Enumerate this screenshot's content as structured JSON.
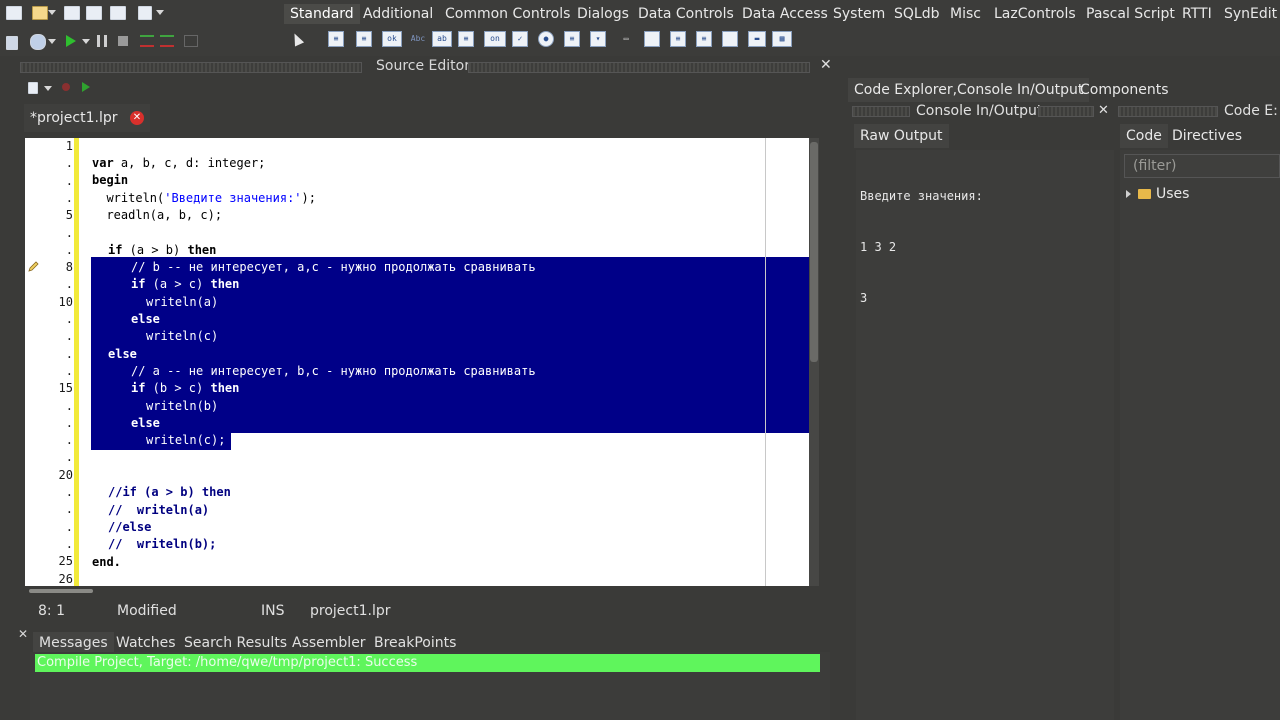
{
  "palette": {
    "tabs": [
      "Standard",
      "Additional",
      "Common Controls",
      "Dialogs",
      "Data Controls",
      "Data Access",
      "System",
      "SQLdb",
      "Misc",
      "LazControls",
      "Pascal Script",
      "RTTI",
      "SynEdit"
    ],
    "active_index": 0
  },
  "source_editor": {
    "title": "Source Editor",
    "close": "✕",
    "tab_label": "*project1.lpr",
    "tab_close": "✕"
  },
  "gutter": {
    "labels": [
      "1",
      ".",
      ".",
      ".",
      "5",
      ".",
      ".",
      "8",
      ".",
      "10",
      ".",
      ".",
      ".",
      ".",
      "15",
      ".",
      ".",
      ".",
      ".",
      "20",
      ".",
      ".",
      ".",
      ".",
      "25",
      "26"
    ]
  },
  "code": {
    "line1": "",
    "line2_kw": "var",
    "line2_rest": " a, b, c, d: integer;",
    "line3": "begin",
    "line4_a": "  writeln(",
    "line4_str": "'Введите значения:'",
    "line4_b": ");",
    "line5": "  readln(a, b, c);",
    "line7_kw1": "if",
    "line7_mid": " (a > b) ",
    "line7_kw2": "then",
    "line8_cmt": "// b -- не интересует, a,c - нужно продолжать сравнивать",
    "line9_kw1": "if",
    "line9_mid": " (a > c) ",
    "line9_kw2": "then",
    "line10": "writeln(a)",
    "line11": "else",
    "line12": "writeln(c)",
    "line13": "else",
    "line14_cmt": "// a -- не интересует, b,c - нужно продолжать сравнивать",
    "line15_kw1": "if",
    "line15_mid": " (b > c) ",
    "line15_kw2": "then",
    "line16": "writeln(b)",
    "line17": "else",
    "line18": "writeln(c);",
    "line22": "//if (a > b) then",
    "line23": "//  writeln(a)",
    "line24": "//else",
    "line25c": "//  writeln(b);",
    "line26": "end."
  },
  "status": {
    "position": "8: 1",
    "state": "Modified",
    "mode": "INS",
    "file": "project1.lpr"
  },
  "messages": {
    "tabs": [
      "Messages",
      "Watches",
      "Search Results",
      "Assembler",
      "BreakPoints"
    ],
    "line": "Compile Project, Target: /home/qwe/tmp/project1: Success"
  },
  "right_dock": {
    "tab_main": "Code Explorer,Console In/Output",
    "tab_components": "Components",
    "console_title": "Console In/Output",
    "console_close": "✕",
    "code_ex_title": "Code E:",
    "raw_output": "Raw Output",
    "console_lines": [
      "Введите значения:",
      "1 3 2",
      "3"
    ],
    "code_tab": "Code",
    "directives_tab": "Directives",
    "filter_placeholder": "(filter)",
    "tree_item": "Uses"
  },
  "colors": {
    "selection": "#000088",
    "success": "#5ff55c",
    "change_bar": "#f2ea3a"
  }
}
